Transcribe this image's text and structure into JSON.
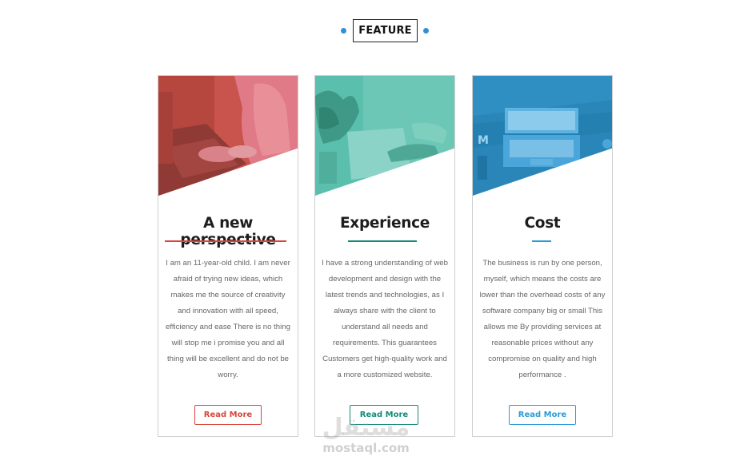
{
  "header": {
    "label": "FEATURE",
    "accent_color": "#2f8fd8"
  },
  "cards": [
    {
      "title": "A new perspective",
      "text": "I am an 11-year-old child. I am never afraid of trying new ideas, which makes me the source of creativity and innovation with all speed, efficiency and ease There is no thing will stop me i promise you and all thing will be excellent and do not be worry.",
      "button": "Read More",
      "accent_color": "#d9463b",
      "image_icon": "laptop-typing-photo"
    },
    {
      "title": "Experience",
      "text": "I have a strong understanding of web development and design with the latest trends and technologies, as I always share with the client to understand all needs and requirements. This guarantees Customers get high-quality work and a more customized website.",
      "button": "Read More",
      "accent_color": "#138a7a",
      "image_icon": "plant-desk-photo"
    },
    {
      "title": "Cost",
      "text": "The business is run by one person, myself, which means the costs are lower than the overhead costs of any software company big or small This allows me By providing services at reasonable prices without any compromise on quality and high performance .",
      "button": "Read More",
      "accent_color": "#2a9bd8",
      "image_icon": "laptop-topview-photo"
    }
  ],
  "watermark": {
    "arabic": "مستقل",
    "latin": "mostaql.com"
  }
}
